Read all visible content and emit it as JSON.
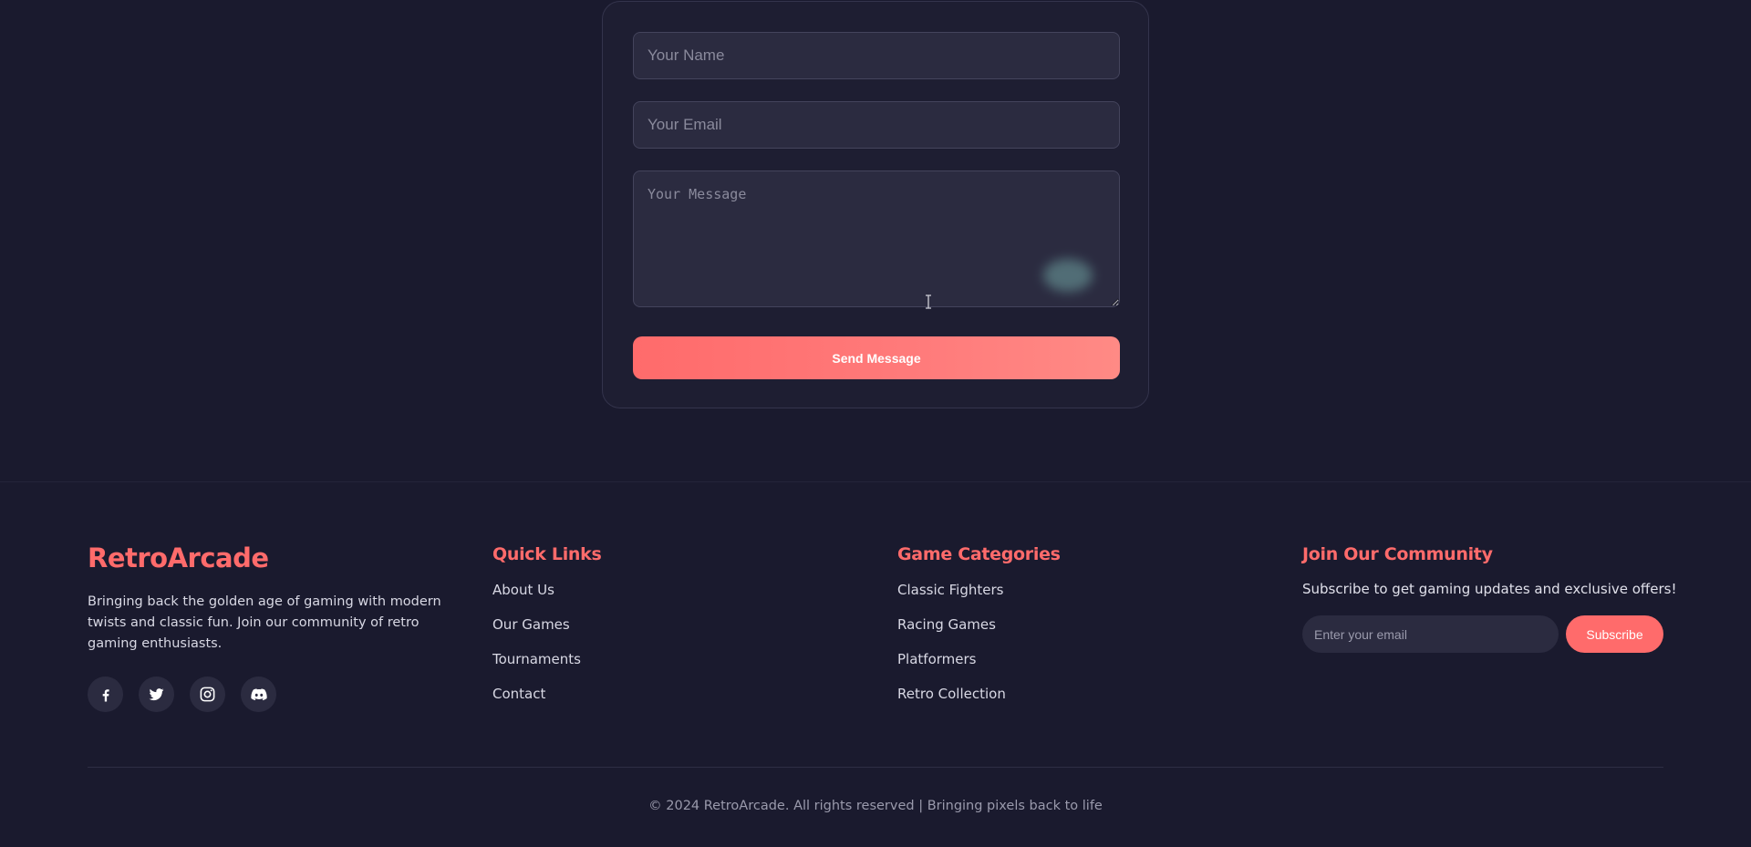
{
  "contact_form": {
    "name_placeholder": "Your Name",
    "email_placeholder": "Your Email",
    "message_placeholder": "Your Message",
    "send_label": "Send Message"
  },
  "footer": {
    "brand": "RetroArcade",
    "description": "Bringing back the golden age of gaming with modern twists and classic fun. Join our community of retro gaming enthusiasts.",
    "socials": [
      "facebook-icon",
      "twitter-icon",
      "instagram-icon",
      "discord-icon"
    ],
    "quick_links": {
      "title": "Quick Links",
      "items": [
        "About Us",
        "Our Games",
        "Tournaments",
        "Contact"
      ]
    },
    "game_categories": {
      "title": "Game Categories",
      "items": [
        "Classic Fighters",
        "Racing Games",
        "Platformers",
        "Retro Collection"
      ]
    },
    "community": {
      "title": "Join Our Community",
      "text": "Subscribe to get gaming updates and exclusive offers!",
      "email_placeholder": "Enter your email",
      "subscribe_label": "Subscribe"
    },
    "copyright": "© 2024 RetroArcade. All rights reserved | Bringing pixels back to life"
  },
  "colors": {
    "background": "#1a1a2e",
    "accent": "#ff6b6b",
    "surface": "#2b2b40"
  }
}
